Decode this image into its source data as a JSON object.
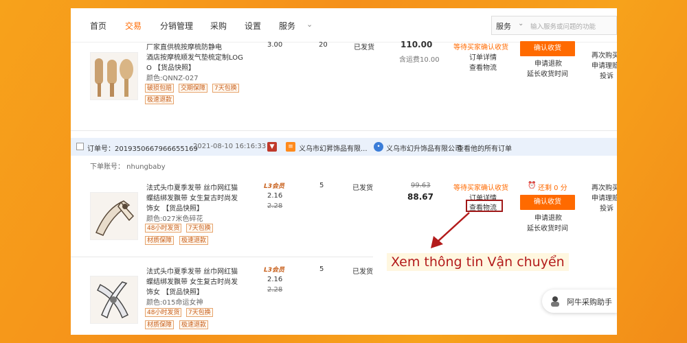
{
  "nav": {
    "items": [
      "首页",
      "交易",
      "分销管理",
      "采购",
      "设置",
      "服务"
    ],
    "active_index": 1,
    "search_select": "服务",
    "search_placeholder": "输入服务或问题的功能"
  },
  "top_item": {
    "title_lines": [
      "厂家直供梳按摩梳防静电",
      "酒店按摩梳顺发气垫梳定制LOG",
      "O 【货品快照】"
    ],
    "color": "颜色:QNNZ-027",
    "tags": [
      "破损包赔",
      "交期保障",
      "7天包换",
      "极速退款"
    ],
    "unit_price": "3.00",
    "quantity": "20",
    "status": "已发货",
    "total": "110.00",
    "shipping_note": "含运费10.00",
    "order_status": "等待买家确认收货",
    "order_links": [
      "订单详情",
      "查看物流"
    ],
    "confirm_label": "确认收货",
    "actions": [
      "申请退款",
      "延长收货时间"
    ],
    "right_actions": [
      "再次购买",
      "申请理赔",
      "投诉"
    ]
  },
  "order_bar": {
    "order_no": "订单号：2019350667966655169",
    "date": "2021-08-10 16:16:33",
    "shop_short": "义乌市幻昇饰品有限...",
    "shop_full": "义乌市幻升饰品有限公司",
    "view_all": "查看他的所有订单"
  },
  "buyer_account": "下单账号： nhungbaby",
  "items": [
    {
      "title_lines": [
        "法式头巾夏季发带 丝巾网红猫",
        "蝶结绑发飘带 女生复古时尚发",
        "饰女 【货品快照】"
      ],
      "color": "颜色:027米色碎花",
      "tags": [
        "48小时发货",
        "7天包换",
        "材质保障",
        "极速退款"
      ],
      "member": "L3会员",
      "unit_price": "2.16",
      "orig_unit_price": "2.28",
      "quantity": "5",
      "status": "已发货"
    },
    {
      "title_lines": [
        "法式头巾夏季发带 丝巾网红猫",
        "蝶结绑发飘带 女生复古时尚发",
        "饰女 【货品快照】"
      ],
      "color": "颜色:015命运女神",
      "tags": [
        "48小时发货",
        "7天包换",
        "材质保障",
        "极速退款"
      ],
      "member": "L3会员",
      "unit_price": "2.16",
      "orig_unit_price": "2.28",
      "quantity": "5",
      "status": "已发货"
    }
  ],
  "order2": {
    "orig_total": "99.63",
    "total": "88.67",
    "order_status": "等待买家确认收货",
    "detail_link": "订单详情",
    "logistics_link": "查看物流",
    "timer": "还剩 0 分",
    "confirm_label": "确认收货",
    "actions": [
      "申请退款",
      "延长收货时间"
    ],
    "right_actions": [
      "再次购买",
      "申请理赔",
      "投诉"
    ]
  },
  "annotation": "Xem thông tin Vận chuyển",
  "assistant_label": "阿牛采购助手",
  "colors": {
    "accent": "#ff6a00",
    "annotation": "#b31b1b",
    "link": "#2f5fb3"
  }
}
